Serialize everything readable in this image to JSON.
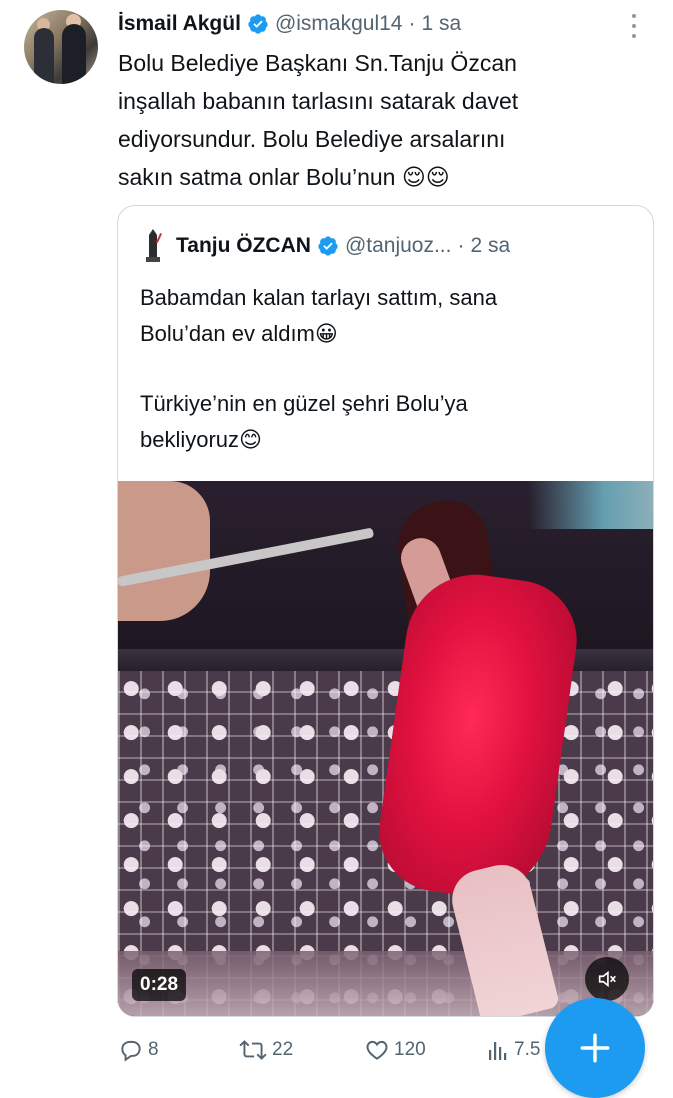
{
  "tweet": {
    "author_name": "İsmail Akgül",
    "author_handle": "@ismakgul14",
    "separator": "·",
    "time": "1 sa",
    "text_lines": [
      "Bolu Belediye Başkanı Sn.Tanju Özcan",
      "inşallah babanın tarlasını satarak davet",
      "ediyorsundur. Bolu Belediye arsalarını",
      "sakın satma onlar Bolu’nun 😌😌"
    ]
  },
  "quote": {
    "author_name": "Tanju ÖZCAN",
    "author_handle": "@tanjuoz...",
    "separator": "·",
    "time": "2 sa",
    "text_lines_1": [
      "Babamdan kalan tarlayı sattım, sana",
      "Bolu’dan ev aldım😀"
    ],
    "text_lines_2": [
      "Türkiye’nin en güzel şehri Bolu’ya",
      "bekliyoruz😊"
    ],
    "video": {
      "duration": "0:28"
    }
  },
  "actions": {
    "replies": "8",
    "retweets": "22",
    "likes": "120",
    "views": "7.5"
  },
  "colors": {
    "accent": "#1d9bf0",
    "secondary_text": "#536471",
    "border": "#cfd9de"
  }
}
